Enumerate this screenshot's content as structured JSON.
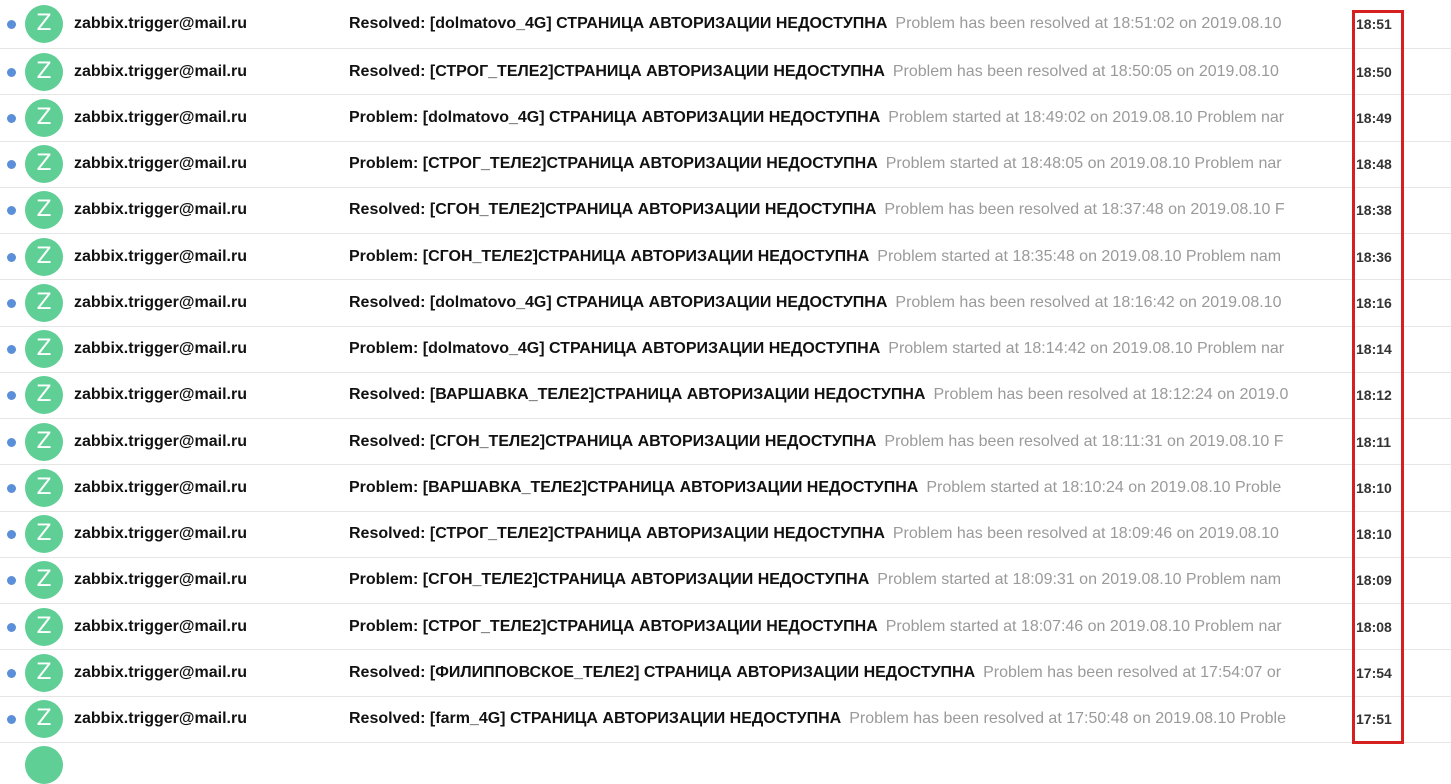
{
  "colors": {
    "avatar": "#5fcf95",
    "unread_dot": "#5b8fd9",
    "highlight_box": "#d61f1f",
    "snippet_text": "#9a9a9a"
  },
  "emails": [
    {
      "avatar_letter": "Z",
      "sender": "zabbix.trigger@mail.ru",
      "subject": "Resolved: [dolmatovo_4G] СТРАНИЦА АВТОРИЗАЦИИ НЕДОСТУПНА",
      "snippet": "Problem has been resolved at 18:51:02 on 2019.08.10",
      "time": "18:51"
    },
    {
      "avatar_letter": "Z",
      "sender": "zabbix.trigger@mail.ru",
      "subject": "Resolved: [СТРОГ_ТЕЛЕ2]СТРАНИЦА АВТОРИЗАЦИИ НЕДОСТУПНА",
      "snippet": "Problem has been resolved at 18:50:05 on 2019.08.10",
      "time": "18:50"
    },
    {
      "avatar_letter": "Z",
      "sender": "zabbix.trigger@mail.ru",
      "subject": "Problem: [dolmatovo_4G] СТРАНИЦА АВТОРИЗАЦИИ НЕДОСТУПНА",
      "snippet": "Problem started at 18:49:02 on 2019.08.10 Problem nar",
      "time": "18:49"
    },
    {
      "avatar_letter": "Z",
      "sender": "zabbix.trigger@mail.ru",
      "subject": "Problem: [СТРОГ_ТЕЛЕ2]СТРАНИЦА АВТОРИЗАЦИИ НЕДОСТУПНА",
      "snippet": "Problem started at 18:48:05 on 2019.08.10 Problem nar",
      "time": "18:48"
    },
    {
      "avatar_letter": "Z",
      "sender": "zabbix.trigger@mail.ru",
      "subject": "Resolved: [СГОН_ТЕЛЕ2]СТРАНИЦА АВТОРИЗАЦИИ НЕДОСТУПНА",
      "snippet": "Problem has been resolved at 18:37:48 on 2019.08.10 F",
      "time": "18:38"
    },
    {
      "avatar_letter": "Z",
      "sender": "zabbix.trigger@mail.ru",
      "subject": "Problem: [СГОН_ТЕЛЕ2]СТРАНИЦА АВТОРИЗАЦИИ НЕДОСТУПНА",
      "snippet": "Problem started at 18:35:48 on 2019.08.10 Problem nam",
      "time": "18:36"
    },
    {
      "avatar_letter": "Z",
      "sender": "zabbix.trigger@mail.ru",
      "subject": "Resolved: [dolmatovo_4G] СТРАНИЦА АВТОРИЗАЦИИ НЕДОСТУПНА",
      "snippet": "Problem has been resolved at 18:16:42 on 2019.08.10",
      "time": "18:16"
    },
    {
      "avatar_letter": "Z",
      "sender": "zabbix.trigger@mail.ru",
      "subject": "Problem: [dolmatovo_4G] СТРАНИЦА АВТОРИЗАЦИИ НЕДОСТУПНА",
      "snippet": "Problem started at 18:14:42 on 2019.08.10 Problem nar",
      "time": "18:14"
    },
    {
      "avatar_letter": "Z",
      "sender": "zabbix.trigger@mail.ru",
      "subject": "Resolved: [ВАРШАВКА_ТЕЛЕ2]СТРАНИЦА АВТОРИЗАЦИИ НЕДОСТУПНА",
      "snippet": "Problem has been resolved at 18:12:24 on 2019.0",
      "time": "18:12"
    },
    {
      "avatar_letter": "Z",
      "sender": "zabbix.trigger@mail.ru",
      "subject": "Resolved: [СГОН_ТЕЛЕ2]СТРАНИЦА АВТОРИЗАЦИИ НЕДОСТУПНА",
      "snippet": "Problem has been resolved at 18:11:31 on 2019.08.10 F",
      "time": "18:11"
    },
    {
      "avatar_letter": "Z",
      "sender": "zabbix.trigger@mail.ru",
      "subject": "Problem: [ВАРШАВКА_ТЕЛЕ2]СТРАНИЦА АВТОРИЗАЦИИ НЕДОСТУПНА",
      "snippet": "Problem started at 18:10:24 on 2019.08.10 Proble",
      "time": "18:10"
    },
    {
      "avatar_letter": "Z",
      "sender": "zabbix.trigger@mail.ru",
      "subject": "Resolved: [СТРОГ_ТЕЛЕ2]СТРАНИЦА АВТОРИЗАЦИИ НЕДОСТУПНА",
      "snippet": "Problem has been resolved at 18:09:46 on 2019.08.10",
      "time": "18:10"
    },
    {
      "avatar_letter": "Z",
      "sender": "zabbix.trigger@mail.ru",
      "subject": "Problem: [СГОН_ТЕЛЕ2]СТРАНИЦА АВТОРИЗАЦИИ НЕДОСТУПНА",
      "snippet": "Problem started at 18:09:31 on 2019.08.10 Problem nam",
      "time": "18:09"
    },
    {
      "avatar_letter": "Z",
      "sender": "zabbix.trigger@mail.ru",
      "subject": "Problem: [СТРОГ_ТЕЛЕ2]СТРАНИЦА АВТОРИЗАЦИИ НЕДОСТУПНА",
      "snippet": "Problem started at 18:07:46 on 2019.08.10 Problem nar",
      "time": "18:08"
    },
    {
      "avatar_letter": "Z",
      "sender": "zabbix.trigger@mail.ru",
      "subject": "Resolved: [ФИЛИППОВСКОЕ_ТЕЛЕ2] СТРАНИЦА АВТОРИЗАЦИИ НЕДОСТУПНА",
      "snippet": "Problem has been resolved at 17:54:07 or",
      "time": "17:54"
    },
    {
      "avatar_letter": "Z",
      "sender": "zabbix.trigger@mail.ru",
      "subject": "Resolved: [farm_4G] СТРАНИЦА АВТОРИЗАЦИИ НЕДОСТУПНА",
      "snippet": "Problem has been resolved at 17:50:48 on 2019.08.10 Proble",
      "time": "17:51"
    }
  ]
}
